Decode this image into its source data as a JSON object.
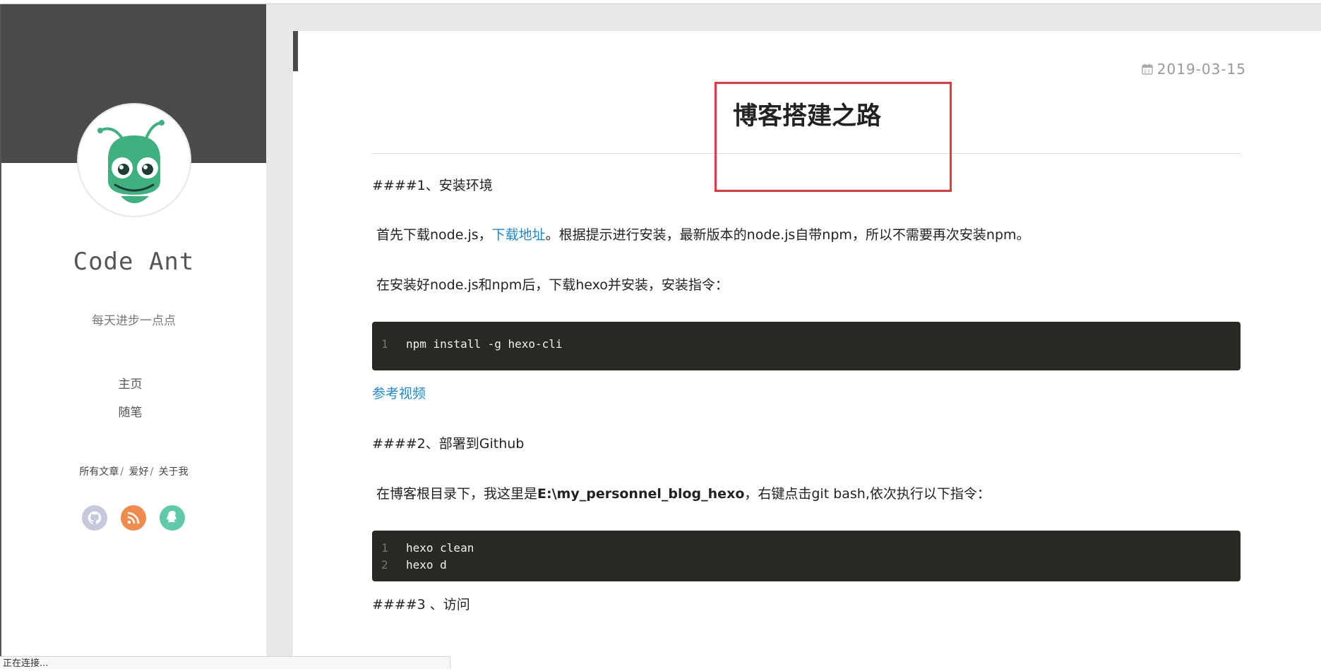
{
  "sidebar": {
    "site_title": "Code Ant",
    "subtitle": "每天进步一点点",
    "nav": [
      {
        "label": "主页"
      },
      {
        "label": "随笔"
      }
    ],
    "links": [
      {
        "label": "所有文章"
      },
      {
        "label": "爱好"
      },
      {
        "label": "关于我"
      }
    ],
    "separator": "/",
    "social_icons": [
      "github-icon",
      "rss-icon",
      "qq-icon"
    ],
    "colors": {
      "banner": "#4a4a4a",
      "avatar_green": "#3fb07f",
      "github_bg": "#c6c8dc",
      "rss_bg": "#ef8c4d",
      "qq_bg": "#5ecaa9"
    }
  },
  "article": {
    "date": "2019-03-15",
    "title": "博客搭建之路",
    "h1": "####1、安装环境",
    "p1_before": "首先下载node.js，",
    "p1_link": "下载地址",
    "p1_after": "。根据提示进行安装，最新版本的node.js自带npm，所以不需要再次安装npm。",
    "p2": "在安装好node.js和npm后，下载hexo并安装，安装指令：",
    "code1": [
      {
        "num": "1",
        "text": "npm install -g hexo-cli"
      }
    ],
    "video_link": "参考视频",
    "h2": "####2、部署到Github",
    "p3_before": "在博客根目录下，我这里是",
    "p3_bold": "E:\\my_personnel_blog_hexo",
    "p3_after": "，右键点击git bash,依次执行以下指令：",
    "code2": [
      {
        "num": "1",
        "text": "hexo clean"
      },
      {
        "num": "2",
        "text": "hexo d"
      }
    ],
    "h3": "####3 、访问",
    "colors": {
      "link": "#1e88d0",
      "code_bg": "#282923",
      "highlight_box": "#e03c3c"
    }
  },
  "status_bar": {
    "text": "正在连接..."
  }
}
